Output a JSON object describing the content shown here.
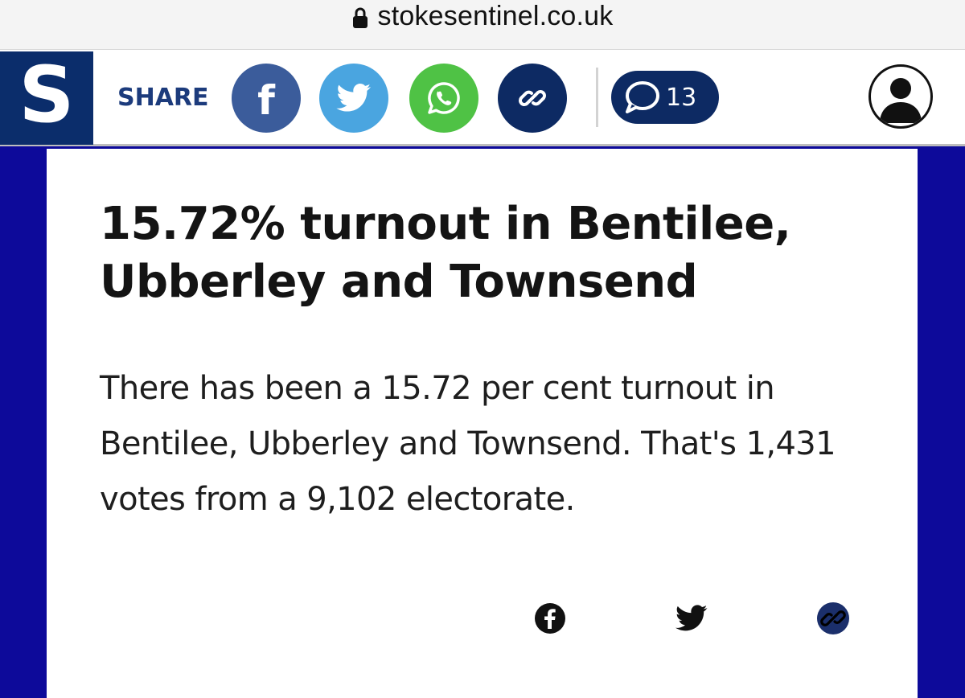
{
  "browser": {
    "url": "stokesentinel.co.uk",
    "lock_icon": "lock-icon"
  },
  "header": {
    "logo_letter": "S",
    "share_label": "SHARE",
    "share_buttons": [
      {
        "name": "facebook",
        "icon": "facebook-icon",
        "color": "#3b5c9b"
      },
      {
        "name": "twitter",
        "icon": "twitter-icon",
        "color": "#4aa5e0"
      },
      {
        "name": "whatsapp",
        "icon": "whatsapp-icon",
        "color": "#4fc245"
      },
      {
        "name": "copy-link",
        "icon": "link-icon",
        "color": "#0d2a63"
      }
    ],
    "comment_count": "13",
    "account_icon": "user-icon"
  },
  "article": {
    "headline": "15.72% turnout in Bentilee, Ubberley and Townsend",
    "body": "There has been a 15.72 per cent turnout in Bentilee, Ubberley and Townsend. That's 1,431 votes from a 9,102 electorate.",
    "share_icons": [
      "facebook-icon",
      "twitter-icon",
      "link-icon"
    ]
  },
  "colors": {
    "page_background": "#0d0a9a",
    "brand_navy": "#0b2d6b"
  }
}
